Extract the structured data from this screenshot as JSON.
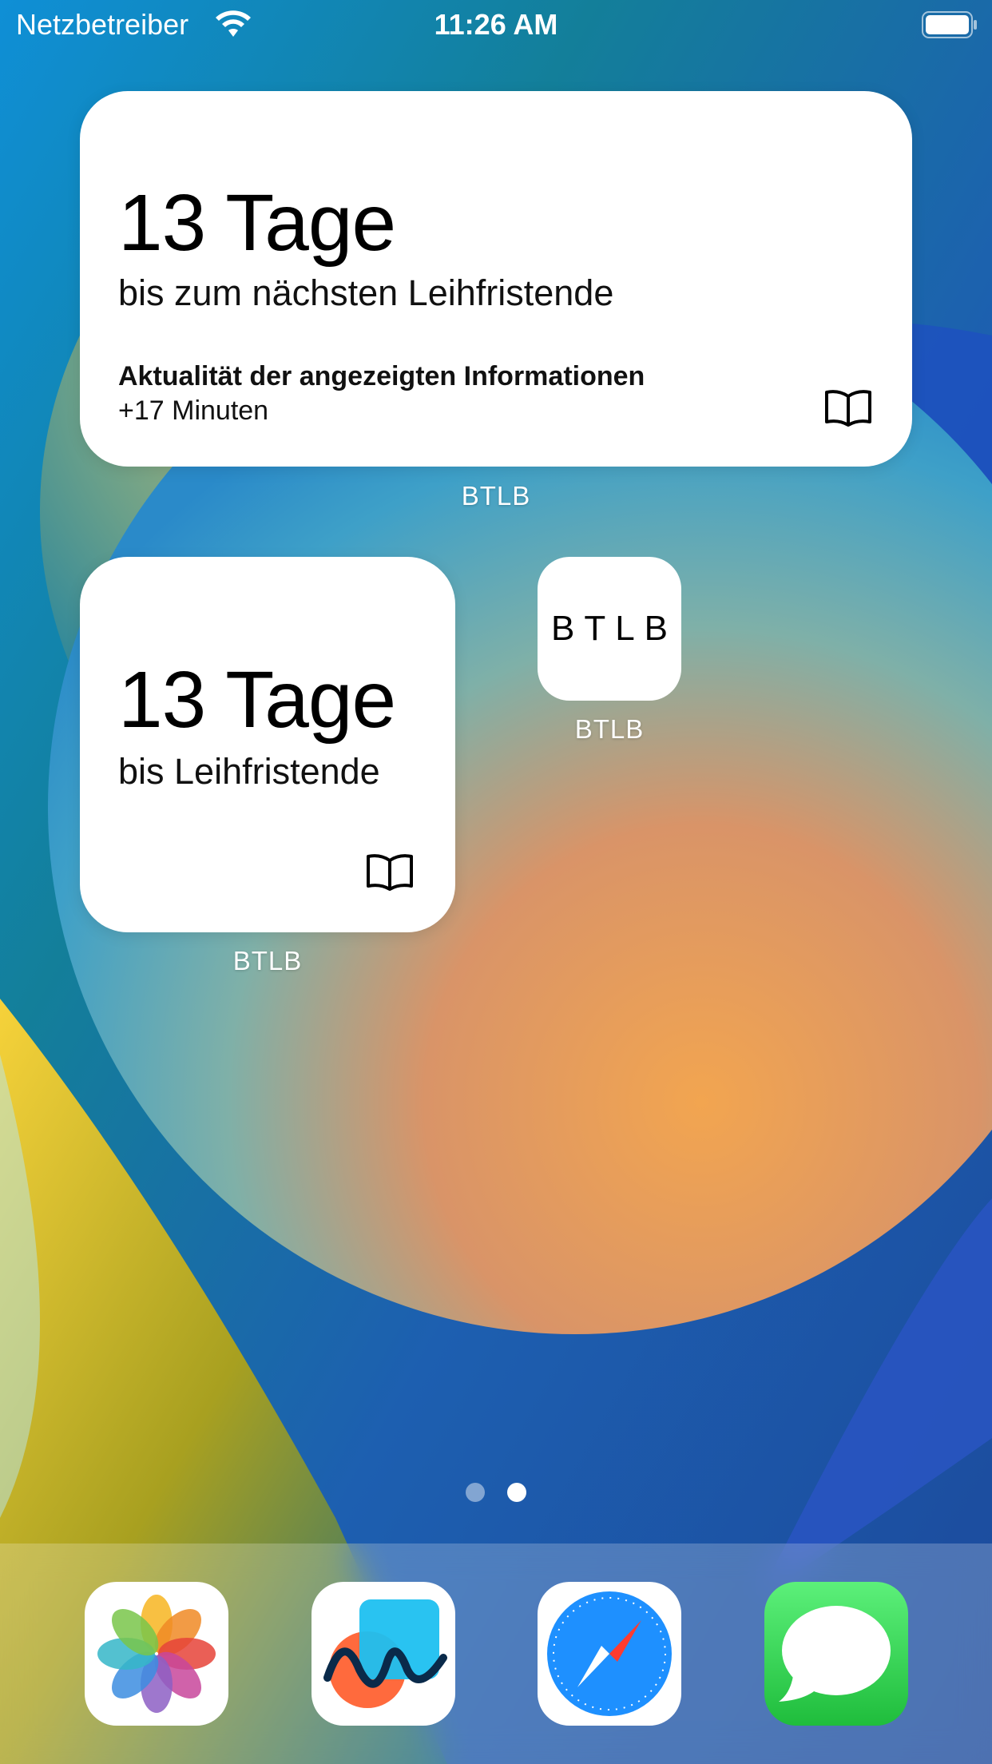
{
  "status_bar": {
    "carrier": "Netzbetreiber",
    "time": "11:26 AM"
  },
  "widget_medium": {
    "days": "13 Tage",
    "subtitle": "bis zum nächsten Leihfristende",
    "info_title": "Aktualität der angezeigten Informationen",
    "info_value": "+17 Minuten",
    "icon": "book-icon"
  },
  "widget_medium_label": "BTLB",
  "widget_small": {
    "days": "13 Tage",
    "subtitle": "bis Leihfristende",
    "icon": "book-icon"
  },
  "widget_small_label": "BTLB",
  "app": {
    "icon_text": "BTLB",
    "label": "BTLB"
  },
  "page_indicator": {
    "pages": 2,
    "current": 2
  },
  "dock": {
    "apps": [
      {
        "icon": "photos-icon"
      },
      {
        "icon": "freeform-icon"
      },
      {
        "icon": "safari-icon"
      },
      {
        "icon": "messages-icon"
      }
    ]
  },
  "colors": {
    "wallpaper_blue": "#1a7fc4",
    "wallpaper_orange": "#f0a050",
    "messages_green": "#34c759",
    "safari_blue": "#1e90ff"
  }
}
